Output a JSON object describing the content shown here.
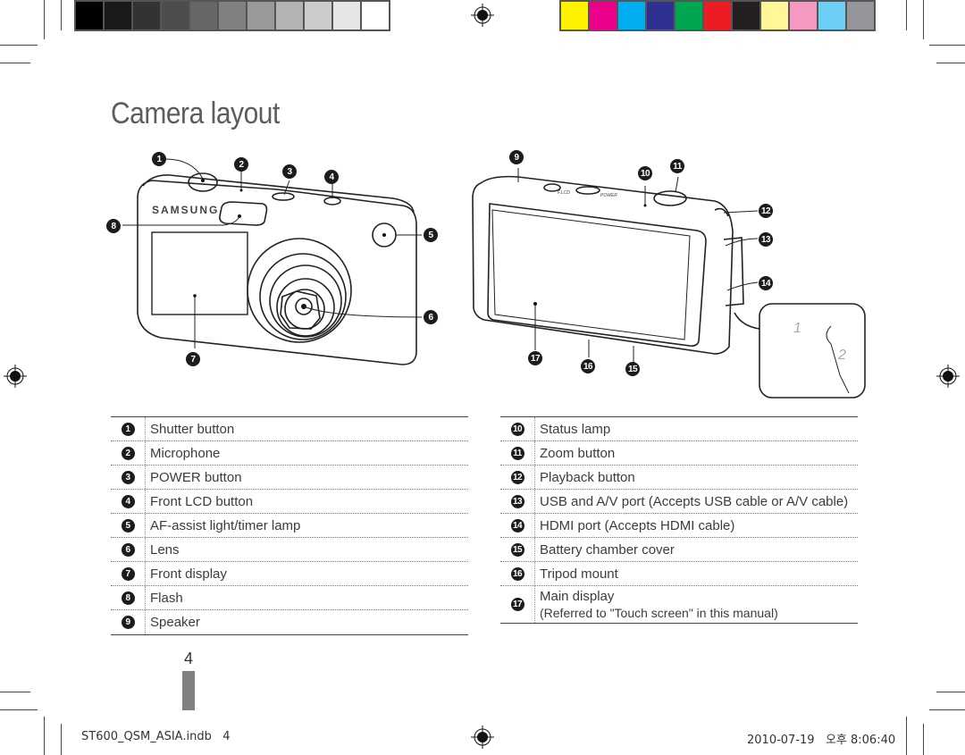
{
  "print_marks": {
    "gray_swatches": [
      "#000000",
      "#1a1a1a",
      "#333333",
      "#4d4d4d",
      "#666666",
      "#808080",
      "#999999",
      "#b3b3b3",
      "#cccccc",
      "#e6e6e6",
      "#ffffff"
    ],
    "color_swatches": [
      "#fff200",
      "#ec008c",
      "#00aeef",
      "#2e3192",
      "#00a651",
      "#ed1c24",
      "#231f20",
      "#fff799",
      "#f49ac1",
      "#6dcff6",
      "#939598"
    ]
  },
  "page": {
    "title": "Camera layout",
    "page_number": "4"
  },
  "front_diagram": {
    "brand_text": "SAMSUNG",
    "callouts": [
      "1",
      "2",
      "3",
      "4",
      "5",
      "6",
      "7",
      "8"
    ]
  },
  "back_diagram": {
    "callouts": [
      "9",
      "10",
      "11",
      "12",
      "13",
      "14",
      "15",
      "16",
      "17"
    ],
    "button_labels": [
      "F.LCD",
      "POWER"
    ],
    "strap_steps": [
      "1",
      "2"
    ]
  },
  "parts_left": [
    {
      "num": "1",
      "label": "Shutter button"
    },
    {
      "num": "2",
      "label": "Microphone"
    },
    {
      "num": "3",
      "label": "POWER button"
    },
    {
      "num": "4",
      "label": "Front LCD button"
    },
    {
      "num": "5",
      "label": "AF-assist light/timer lamp"
    },
    {
      "num": "6",
      "label": "Lens"
    },
    {
      "num": "7",
      "label": "Front display"
    },
    {
      "num": "8",
      "label": "Flash"
    },
    {
      "num": "9",
      "label": "Speaker"
    }
  ],
  "parts_right": [
    {
      "num": "10",
      "label": "Status lamp"
    },
    {
      "num": "11",
      "label": "Zoom button"
    },
    {
      "num": "12",
      "label": "Playback button"
    },
    {
      "num": "13",
      "label": "USB and A/V port (Accepts USB cable or A/V cable)"
    },
    {
      "num": "14",
      "label": "HDMI port (Accepts HDMI cable)"
    },
    {
      "num": "15",
      "label": "Battery chamber cover"
    },
    {
      "num": "16",
      "label": "Tripod mount"
    },
    {
      "num": "17",
      "label": "Main display",
      "sublabel": "(Referred to \"Touch screen\" in this manual)"
    }
  ],
  "footer": {
    "file": "ST600_QSM_ASIA.indb   4",
    "timestamp": "2010-07-19   오후 8:06:40"
  }
}
